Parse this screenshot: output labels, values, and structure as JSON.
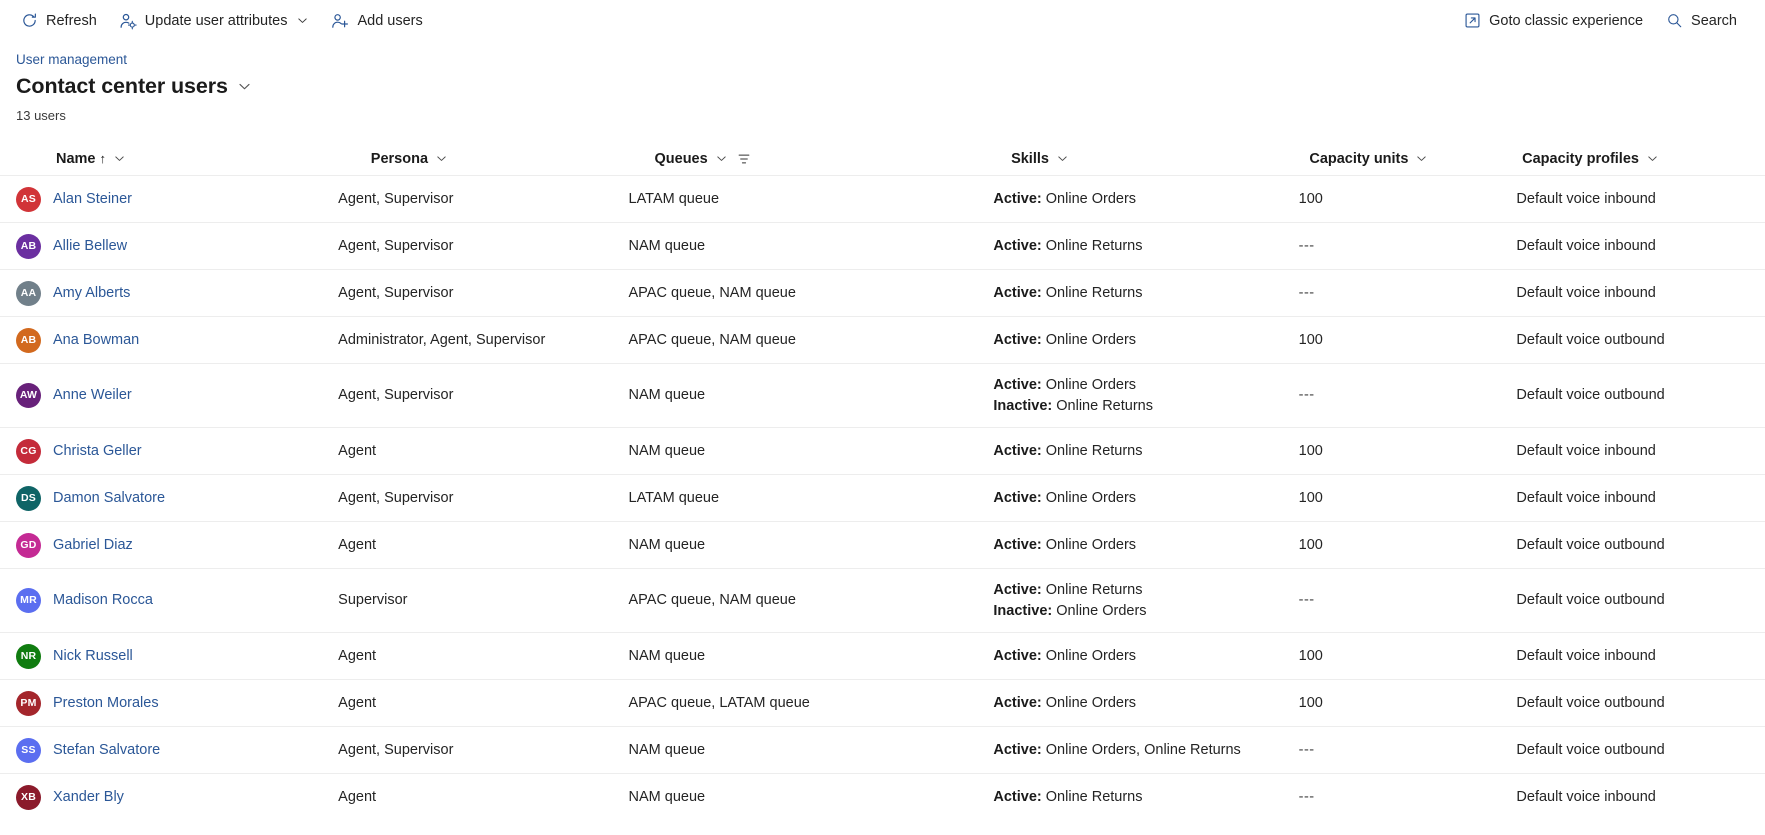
{
  "commandbar": {
    "left_items": [
      {
        "label": "Refresh",
        "icon": "refresh-icon",
        "has_chevron": false
      },
      {
        "label": "Update user attributes",
        "icon": "user-settings-icon",
        "has_chevron": true
      },
      {
        "label": "Add users",
        "icon": "add-user-icon",
        "has_chevron": false
      }
    ],
    "right_items": [
      {
        "label": "Goto classic experience",
        "icon": "external-link-icon",
        "has_chevron": false
      },
      {
        "label": "Search",
        "icon": "search-icon",
        "has_chevron": false
      }
    ]
  },
  "header": {
    "breadcrumb": "User management",
    "title": "Contact center users",
    "count_label": "13 users"
  },
  "grid": {
    "columns": [
      {
        "label": "Name",
        "sorted": true,
        "sort_glyph": "↑",
        "has_filter": false
      },
      {
        "label": "Persona",
        "sorted": false,
        "has_filter": false
      },
      {
        "label": "Queues",
        "sorted": false,
        "has_filter": true
      },
      {
        "label": "Skills",
        "sorted": false,
        "has_filter": false
      },
      {
        "label": "Capacity units",
        "sorted": false,
        "has_filter": false
      },
      {
        "label": "Capacity profiles",
        "sorted": false,
        "has_filter": false
      }
    ],
    "rows": [
      {
        "initials": "AS",
        "avatar_color": "#d13438",
        "name": "Alan Steiner",
        "persona": "Agent, Supervisor",
        "queues": "LATAM queue",
        "skills": [
          {
            "state": "Active:",
            "value": "Online Orders"
          }
        ],
        "capacity_units": "100",
        "capacity_profiles": "Default voice inbound"
      },
      {
        "initials": "AB",
        "avatar_color": "#6b2fa0",
        "name": "Allie Bellew",
        "persona": "Agent, Supervisor",
        "queues": "NAM queue",
        "skills": [
          {
            "state": "Active:",
            "value": "Online Returns"
          }
        ],
        "capacity_units": "---",
        "capacity_profiles": "Default voice inbound"
      },
      {
        "initials": "AA",
        "avatar_color": "#71808a",
        "name": "Amy Alberts",
        "persona": "Agent, Supervisor",
        "queues": "APAC queue, NAM queue",
        "skills": [
          {
            "state": "Active:",
            "value": "Online Returns"
          }
        ],
        "capacity_units": "---",
        "capacity_profiles": "Default voice inbound"
      },
      {
        "initials": "AB",
        "avatar_color": "#d2691e",
        "name": "Ana Bowman",
        "persona": "Administrator, Agent, Supervisor",
        "queues": "APAC queue, NAM queue",
        "skills": [
          {
            "state": "Active:",
            "value": "Online Orders"
          }
        ],
        "capacity_units": "100",
        "capacity_profiles": "Default voice outbound"
      },
      {
        "initials": "AW",
        "avatar_color": "#68217a",
        "name": "Anne Weiler",
        "persona": "Agent, Supervisor",
        "queues": "NAM queue",
        "skills": [
          {
            "state": "Active:",
            "value": "Online Orders"
          },
          {
            "state": "Inactive:",
            "value": "Online Returns"
          }
        ],
        "capacity_units": "---",
        "capacity_profiles": "Default voice outbound"
      },
      {
        "initials": "CG",
        "avatar_color": "#c42b3a",
        "name": "Christa Geller",
        "persona": "Agent",
        "queues": "NAM queue",
        "skills": [
          {
            "state": "Active:",
            "value": "Online Returns"
          }
        ],
        "capacity_units": "100",
        "capacity_profiles": "Default voice inbound"
      },
      {
        "initials": "DS",
        "avatar_color": "#0f6466",
        "name": "Damon Salvatore",
        "persona": "Agent, Supervisor",
        "queues": "LATAM queue",
        "skills": [
          {
            "state": "Active:",
            "value": "Online Orders"
          }
        ],
        "capacity_units": "100",
        "capacity_profiles": "Default voice inbound"
      },
      {
        "initials": "GD",
        "avatar_color": "#c42a94",
        "name": "Gabriel Diaz",
        "persona": "Agent",
        "queues": "NAM queue",
        "skills": [
          {
            "state": "Active:",
            "value": "Online Orders"
          }
        ],
        "capacity_units": "100",
        "capacity_profiles": "Default voice outbound"
      },
      {
        "initials": "MR",
        "avatar_color": "#5b6ef0",
        "name": "Madison Rocca",
        "persona": "Supervisor",
        "queues": "APAC queue, NAM queue",
        "skills": [
          {
            "state": "Active:",
            "value": "Online Returns"
          },
          {
            "state": "Inactive:",
            "value": "Online Orders"
          }
        ],
        "capacity_units": "---",
        "capacity_profiles": "Default voice outbound"
      },
      {
        "initials": "NR",
        "avatar_color": "#107c10",
        "name": "Nick Russell",
        "persona": "Agent",
        "queues": "NAM queue",
        "skills": [
          {
            "state": "Active:",
            "value": "Online Orders"
          }
        ],
        "capacity_units": "100",
        "capacity_profiles": "Default voice inbound"
      },
      {
        "initials": "PM",
        "avatar_color": "#a4262c",
        "name": "Preston Morales",
        "persona": "Agent",
        "queues": "APAC queue, LATAM queue",
        "skills": [
          {
            "state": "Active:",
            "value": "Online Orders"
          }
        ],
        "capacity_units": "100",
        "capacity_profiles": "Default voice outbound"
      },
      {
        "initials": "SS",
        "avatar_color": "#5b6ef0",
        "name": "Stefan Salvatore",
        "persona": "Agent, Supervisor",
        "queues": "NAM queue",
        "skills": [
          {
            "state": "Active:",
            "value": "Online Orders, Online Returns"
          }
        ],
        "capacity_units": "---",
        "capacity_profiles": "Default voice outbound"
      },
      {
        "initials": "XB",
        "avatar_color": "#8b1a2b",
        "name": "Xander Bly",
        "persona": "Agent",
        "queues": "NAM queue",
        "skills": [
          {
            "state": "Active:",
            "value": "Online Returns"
          }
        ],
        "capacity_units": "---",
        "capacity_profiles": "Default voice inbound"
      }
    ]
  },
  "colors": {
    "link": "#2b5797",
    "text": "#242424",
    "row_divider": "#ededed"
  }
}
